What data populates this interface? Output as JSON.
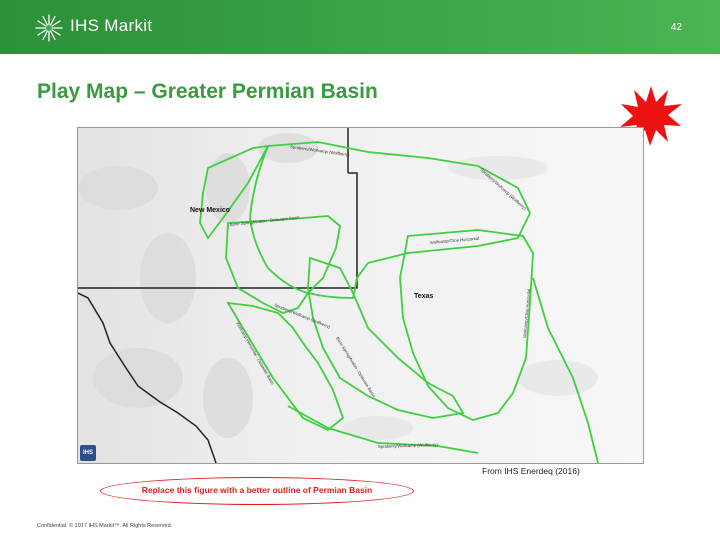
{
  "header": {
    "brand": "IHS Markit",
    "page_number": "42",
    "logo_icon": "ihs-starburst-icon",
    "background_color": "#3da447"
  },
  "slide": {
    "title": "Play Map – Greater Permian Basin",
    "title_color": "#3a9a3f"
  },
  "map": {
    "state_labels": [
      "New Mexico",
      "Texas"
    ],
    "play_labels": [
      "Spraberry/Wolfcamp (Wolfberry)",
      "Spraberry/Wolfcamp (Wolfberry)",
      "Bone Spring/Avalon - Delaware Basin",
      "Bone Spring/Avalon - Delaware Basin",
      "Wolfcamp/Cline Horizontal",
      "Wolfcamp/Cline Horizontal",
      "Spraberry/Wolfcamp (Wolfberry)",
      "Wolfcamp Horizontal - Delaware Basin",
      "Spraberry/Wolfcamp (Wolfberry)"
    ],
    "badge": "IHS",
    "play_outline_color": "#3fcf3f",
    "boundary_color": "#222222"
  },
  "source": "From IHS Enerdeq (2016)",
  "note": {
    "text": "Replace this figure with a better outline of Permian Basin",
    "color": "#e02020"
  },
  "burst_icon": "red-starburst-icon",
  "footer": "Confidential. © 2017 IHS Markit™. All Rights Reserved."
}
